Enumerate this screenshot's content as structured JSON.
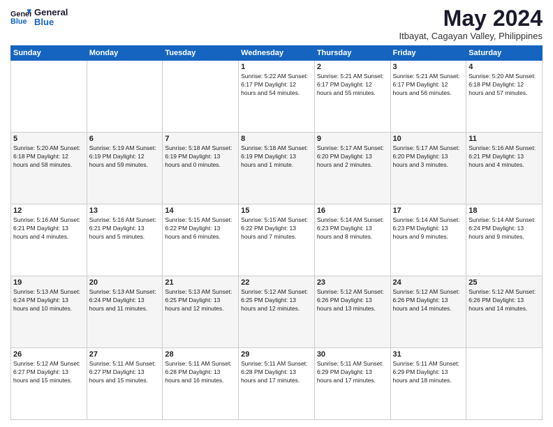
{
  "header": {
    "logo_line1": "General",
    "logo_line2": "Blue",
    "month": "May 2024",
    "location": "Itbayat, Cagayan Valley, Philippines"
  },
  "weekdays": [
    "Sunday",
    "Monday",
    "Tuesday",
    "Wednesday",
    "Thursday",
    "Friday",
    "Saturday"
  ],
  "weeks": [
    [
      {
        "day": "",
        "info": ""
      },
      {
        "day": "",
        "info": ""
      },
      {
        "day": "",
        "info": ""
      },
      {
        "day": "1",
        "info": "Sunrise: 5:22 AM\nSunset: 6:17 PM\nDaylight: 12 hours\nand 54 minutes."
      },
      {
        "day": "2",
        "info": "Sunrise: 5:21 AM\nSunset: 6:17 PM\nDaylight: 12 hours\nand 55 minutes."
      },
      {
        "day": "3",
        "info": "Sunrise: 5:21 AM\nSunset: 6:17 PM\nDaylight: 12 hours\nand 56 minutes."
      },
      {
        "day": "4",
        "info": "Sunrise: 5:20 AM\nSunset: 6:18 PM\nDaylight: 12 hours\nand 57 minutes."
      }
    ],
    [
      {
        "day": "5",
        "info": "Sunrise: 5:20 AM\nSunset: 6:18 PM\nDaylight: 12 hours\nand 58 minutes."
      },
      {
        "day": "6",
        "info": "Sunrise: 5:19 AM\nSunset: 6:19 PM\nDaylight: 12 hours\nand 59 minutes."
      },
      {
        "day": "7",
        "info": "Sunrise: 5:18 AM\nSunset: 6:19 PM\nDaylight: 13 hours\nand 0 minutes."
      },
      {
        "day": "8",
        "info": "Sunrise: 5:18 AM\nSunset: 6:19 PM\nDaylight: 13 hours\nand 1 minute."
      },
      {
        "day": "9",
        "info": "Sunrise: 5:17 AM\nSunset: 6:20 PM\nDaylight: 13 hours\nand 2 minutes."
      },
      {
        "day": "10",
        "info": "Sunrise: 5:17 AM\nSunset: 6:20 PM\nDaylight: 13 hours\nand 3 minutes."
      },
      {
        "day": "11",
        "info": "Sunrise: 5:16 AM\nSunset: 6:21 PM\nDaylight: 13 hours\nand 4 minutes."
      }
    ],
    [
      {
        "day": "12",
        "info": "Sunrise: 5:16 AM\nSunset: 6:21 PM\nDaylight: 13 hours\nand 4 minutes."
      },
      {
        "day": "13",
        "info": "Sunrise: 5:16 AM\nSunset: 6:21 PM\nDaylight: 13 hours\nand 5 minutes."
      },
      {
        "day": "14",
        "info": "Sunrise: 5:15 AM\nSunset: 6:22 PM\nDaylight: 13 hours\nand 6 minutes."
      },
      {
        "day": "15",
        "info": "Sunrise: 5:15 AM\nSunset: 6:22 PM\nDaylight: 13 hours\nand 7 minutes."
      },
      {
        "day": "16",
        "info": "Sunrise: 5:14 AM\nSunset: 6:23 PM\nDaylight: 13 hours\nand 8 minutes."
      },
      {
        "day": "17",
        "info": "Sunrise: 5:14 AM\nSunset: 6:23 PM\nDaylight: 13 hours\nand 9 minutes."
      },
      {
        "day": "18",
        "info": "Sunrise: 5:14 AM\nSunset: 6:24 PM\nDaylight: 13 hours\nand 9 minutes."
      }
    ],
    [
      {
        "day": "19",
        "info": "Sunrise: 5:13 AM\nSunset: 6:24 PM\nDaylight: 13 hours\nand 10 minutes."
      },
      {
        "day": "20",
        "info": "Sunrise: 5:13 AM\nSunset: 6:24 PM\nDaylight: 13 hours\nand 11 minutes."
      },
      {
        "day": "21",
        "info": "Sunrise: 5:13 AM\nSunset: 6:25 PM\nDaylight: 13 hours\nand 12 minutes."
      },
      {
        "day": "22",
        "info": "Sunrise: 5:12 AM\nSunset: 6:25 PM\nDaylight: 13 hours\nand 12 minutes."
      },
      {
        "day": "23",
        "info": "Sunrise: 5:12 AM\nSunset: 6:26 PM\nDaylight: 13 hours\nand 13 minutes."
      },
      {
        "day": "24",
        "info": "Sunrise: 5:12 AM\nSunset: 6:26 PM\nDaylight: 13 hours\nand 14 minutes."
      },
      {
        "day": "25",
        "info": "Sunrise: 5:12 AM\nSunset: 6:26 PM\nDaylight: 13 hours\nand 14 minutes."
      }
    ],
    [
      {
        "day": "26",
        "info": "Sunrise: 5:12 AM\nSunset: 6:27 PM\nDaylight: 13 hours\nand 15 minutes."
      },
      {
        "day": "27",
        "info": "Sunrise: 5:11 AM\nSunset: 6:27 PM\nDaylight: 13 hours\nand 15 minutes."
      },
      {
        "day": "28",
        "info": "Sunrise: 5:11 AM\nSunset: 6:28 PM\nDaylight: 13 hours\nand 16 minutes."
      },
      {
        "day": "29",
        "info": "Sunrise: 5:11 AM\nSunset: 6:28 PM\nDaylight: 13 hours\nand 17 minutes."
      },
      {
        "day": "30",
        "info": "Sunrise: 5:11 AM\nSunset: 6:29 PM\nDaylight: 13 hours\nand 17 minutes."
      },
      {
        "day": "31",
        "info": "Sunrise: 5:11 AM\nSunset: 6:29 PM\nDaylight: 13 hours\nand 18 minutes."
      },
      {
        "day": "",
        "info": ""
      }
    ]
  ]
}
